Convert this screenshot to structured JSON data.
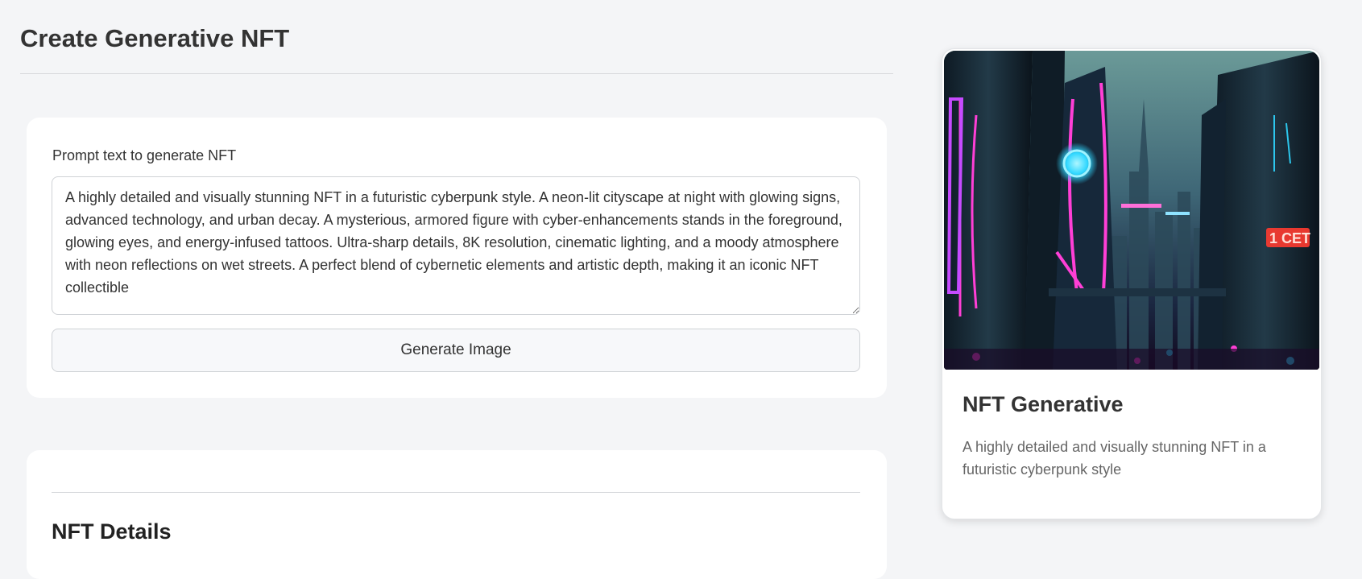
{
  "page": {
    "title": "Create Generative NFT"
  },
  "prompt_form": {
    "label": "Prompt text to generate NFT",
    "value": "A highly detailed and visually stunning NFT in a futuristic cyberpunk style. A neon-lit cityscape at night with glowing signs, advanced technology, and urban decay. A mysterious, armored figure with cyber-enhancements stands in the foreground, glowing eyes, and energy-infused tattoos. Ultra-sharp details, 8K resolution, cinematic lighting, and a moody atmosphere with neon reflections on wet streets. A perfect blend of cybernetic elements and artistic depth, making it an iconic NFT collectible",
    "generate_label": "Generate Image"
  },
  "details": {
    "title": "NFT Details"
  },
  "preview": {
    "image_sign_text": "1 CET",
    "title": "NFT Generative",
    "description": "A highly detailed and visually stunning NFT in a futuristic cyberpunk style"
  },
  "colors": {
    "page_background": "#f4f5f7",
    "card_background": "#ffffff",
    "neon_pink": "#ff3fd6",
    "neon_cyan": "#2fd7ff",
    "neon_red": "#ff3b30"
  }
}
